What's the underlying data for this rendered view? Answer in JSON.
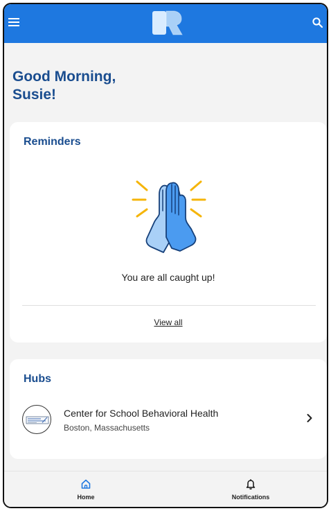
{
  "app_bar": {
    "menu_icon": "hamburger-menu-icon",
    "logo": "app-logo",
    "search_icon": "search-icon",
    "color": "#1e78e0"
  },
  "greeting": "Good Morning,\nSusie!",
  "reminders": {
    "title": "Reminders",
    "illustration": "high-five-icon",
    "empty_message": "You are all caught up!",
    "view_all_label": "View all"
  },
  "hubs": {
    "title": "Hubs",
    "items": [
      {
        "name": "Center for School Behavioral Health",
        "location": "Boston, Massachusetts",
        "avatar_icon": "hub-logo-icon",
        "chevron_icon": "chevron-right-icon"
      }
    ]
  },
  "bottom_nav": {
    "items": [
      {
        "label": "Home",
        "icon": "home-icon",
        "active": true
      },
      {
        "label": "Notifications",
        "icon": "bell-icon",
        "active": false
      }
    ]
  },
  "colors": {
    "accent": "#1e78e0",
    "heading": "#1a4d8f",
    "background": "#f3f3f3"
  }
}
